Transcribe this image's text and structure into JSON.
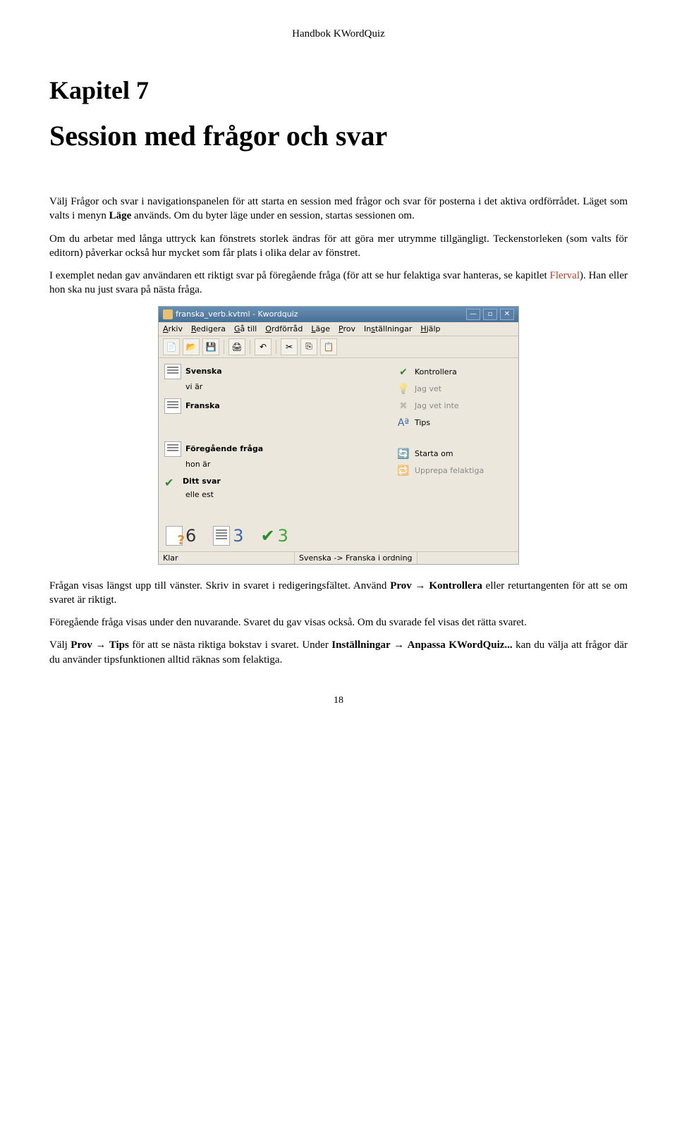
{
  "doc": {
    "header": "Handbok KWordQuiz",
    "chapter_num": "Kapitel 7",
    "chapter_title": "Session med frågor och svar",
    "para1_a": "Välj Frågor och svar i navigationspanelen för att starta en session med frågor och svar för posterna i det aktiva ordförrådet. Läget som valts i menyn ",
    "para1_bold": "Läge",
    "para1_b": " används. Om du byter läge under en session, startas sessionen om.",
    "para2": "Om du arbetar med långa uttryck kan fönstrets storlek ändras för att göra mer utrymme tillgängligt. Teckenstorleken (som valts för editorn) påverkar också hur mycket som får plats i olika delar av fönstret.",
    "para3_a": "I exemplet nedan gav användaren ett riktigt svar på föregående fråga (för att se hur felaktiga svar hanteras, se kapitlet ",
    "para3_link": "Flerval",
    "para3_b": "). Han eller hon ska nu just svara på nästa fråga.",
    "para4_a": "Frågan visas längst upp till vänster. Skriv in svaret i redigeringsfältet. Använd ",
    "para4_b1": "Prov",
    "para4_arrow": " → ",
    "para4_b2": "Kontrollera",
    "para4_b": " eller returtangenten för att se om svaret är riktigt.",
    "para5": "Föregående fråga visas under den nuvarande. Svaret du gav visas också. Om du svarade fel visas det rätta svaret.",
    "para6_a": "Välj ",
    "para6_b1": "Prov",
    "para6_b2": "Tips",
    "para6_b": " för att se nästa riktiga bokstav i svaret. Under ",
    "para6_b3": "Inställningar",
    "para6_b4": "Anpassa KWordQuiz...",
    "para6_c": " kan du välja att frågor där du använder tipsfunktionen alltid räknas som felaktiga.",
    "page_num": "18"
  },
  "app": {
    "title": "franska_verb.kvtml - Kwordquiz",
    "menu": {
      "m0": "Arkiv",
      "m1": "Redigera",
      "m2": "Gå till",
      "m3": "Ordförråd",
      "m4": "Läge",
      "m5": "Prov",
      "m6": "Inställningar",
      "m7": "Hjälp"
    },
    "left": {
      "lang1": "Svenska",
      "val1": "vi är",
      "lang2": "Franska",
      "prev_label": "Föregående fråga",
      "prev_val": "hon är",
      "your_label": "Ditt svar",
      "your_val": "elle est"
    },
    "right": {
      "a0": "Kontrollera",
      "a1": "Jag vet",
      "a2": "Jag vet inte",
      "a3": "Tips",
      "a4": "Starta om",
      "a5": "Upprepa felaktiga"
    },
    "stats": {
      "s0": "6",
      "s1": "3",
      "s2": "3"
    },
    "status": {
      "left": "Klar",
      "right": "Svenska -> Franska i ordning"
    }
  }
}
